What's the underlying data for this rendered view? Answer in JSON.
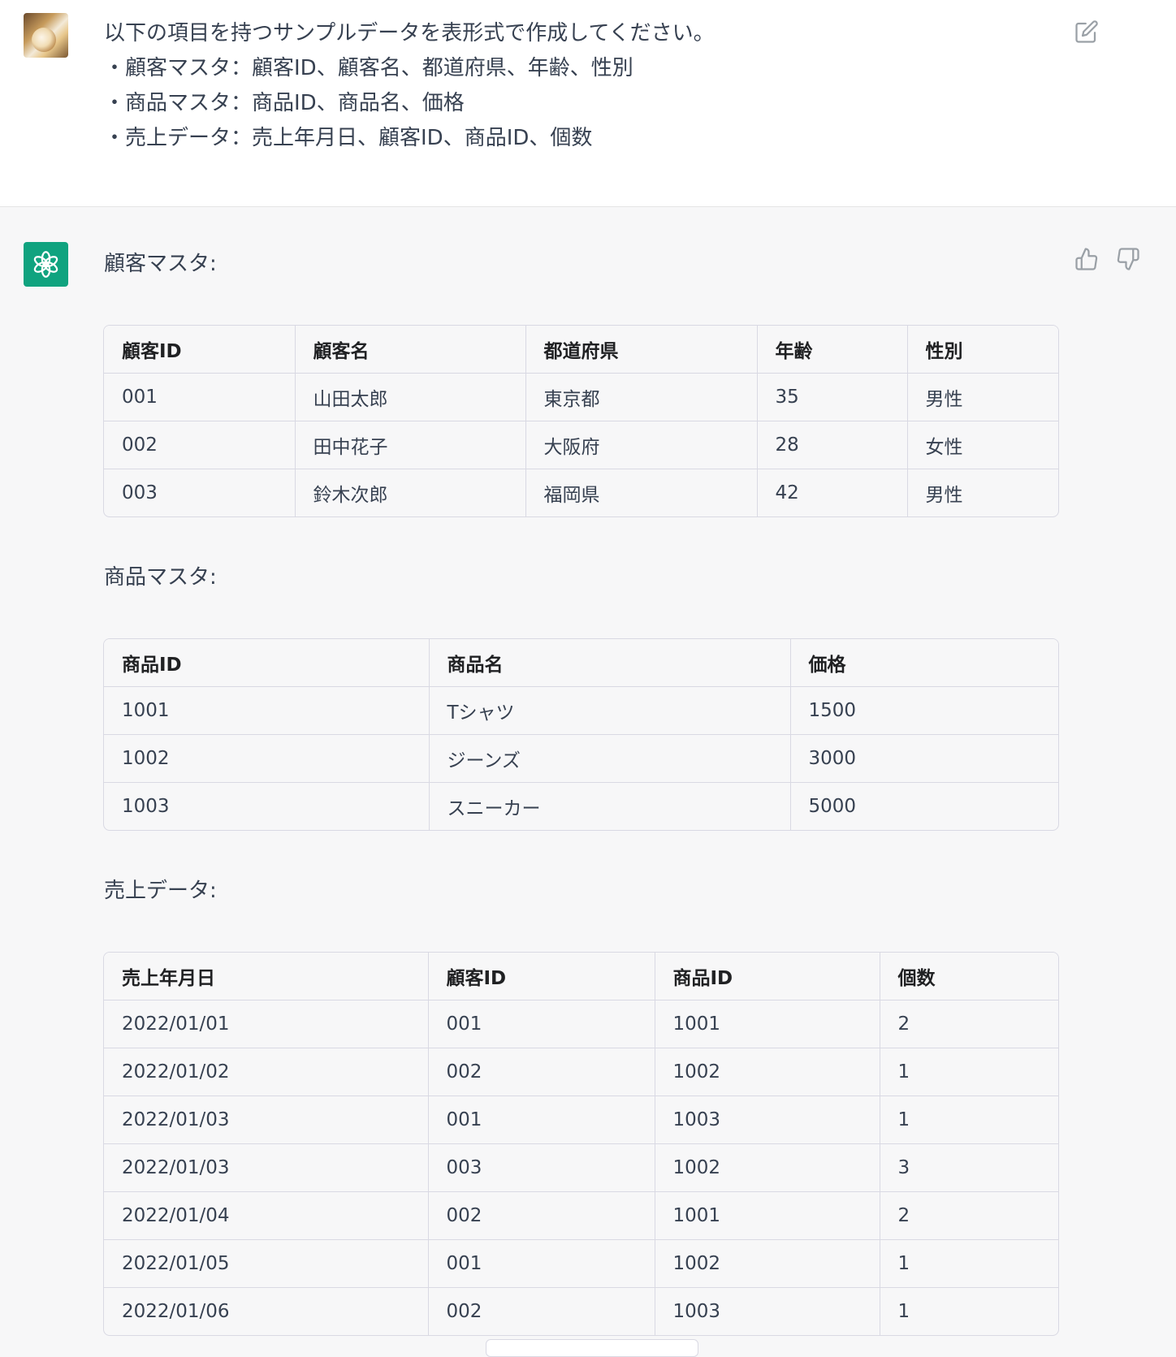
{
  "user": {
    "message_lines": [
      "以下の項目を持つサンプルデータを表形式で作成してください。",
      "・顧客マスタ：顧客ID、顧客名、都道府県、年齢、性別",
      "・商品マスタ：商品ID、商品名、価格",
      "・売上データ：売上年月日、顧客ID、商品ID、個数"
    ]
  },
  "icons": {
    "edit": "edit-icon",
    "thumbs_up": "thumbs-up-icon",
    "thumbs_down": "thumbs-down-icon",
    "bot_logo": "openai-logo-icon"
  },
  "colors": {
    "bot_avatar": "#10a37f",
    "response_background": "#f7f7f8",
    "user_background": "#ffffff"
  },
  "response": {
    "customer_section": {
      "label": "顧客マスタ:",
      "headers": [
        "顧客ID",
        "顧客名",
        "都道府県",
        "年齢",
        "性別"
      ],
      "rows": [
        [
          "001",
          "山田太郎",
          "東京都",
          "35",
          "男性"
        ],
        [
          "002",
          "田中花子",
          "大阪府",
          "28",
          "女性"
        ],
        [
          "003",
          "鈴木次郎",
          "福岡県",
          "42",
          "男性"
        ]
      ]
    },
    "product_section": {
      "label": "商品マスタ:",
      "headers": [
        "商品ID",
        "商品名",
        "価格"
      ],
      "rows": [
        [
          "1001",
          "Tシャツ",
          "1500"
        ],
        [
          "1002",
          "ジーンズ",
          "3000"
        ],
        [
          "1003",
          "スニーカー",
          "5000"
        ]
      ]
    },
    "sales_section": {
      "label": "売上データ:",
      "headers": [
        "売上年月日",
        "顧客ID",
        "商品ID",
        "個数"
      ],
      "rows": [
        [
          "2022/01/01",
          "001",
          "1001",
          "2"
        ],
        [
          "2022/01/02",
          "002",
          "1002",
          "1"
        ],
        [
          "2022/01/03",
          "001",
          "1003",
          "1"
        ],
        [
          "2022/01/03",
          "003",
          "1002",
          "3"
        ],
        [
          "2022/01/04",
          "002",
          "1001",
          "2"
        ],
        [
          "2022/01/05",
          "001",
          "1002",
          "1"
        ],
        [
          "2022/01/06",
          "002",
          "1003",
          "1"
        ]
      ]
    }
  }
}
